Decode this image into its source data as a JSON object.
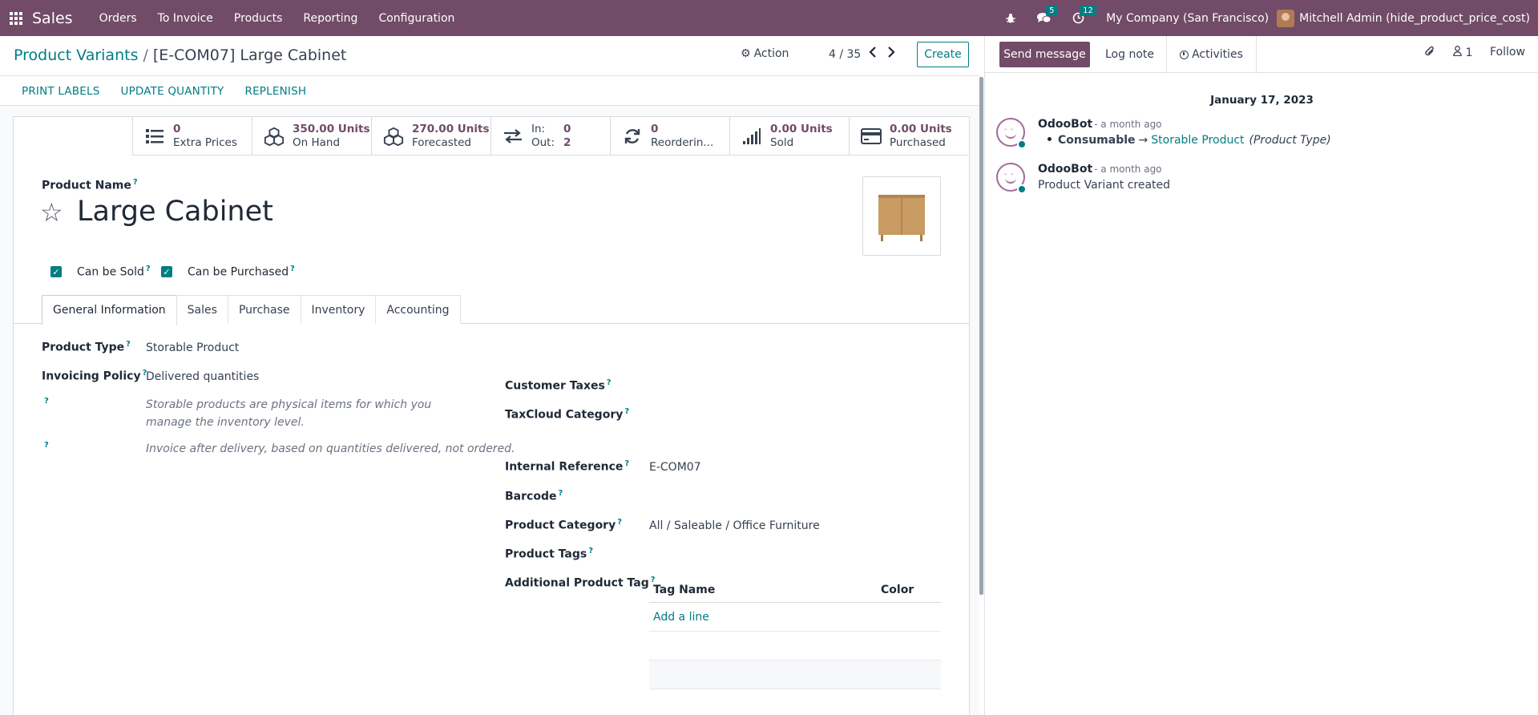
{
  "navbar": {
    "app_name": "Sales",
    "menu": [
      "Orders",
      "To Invoice",
      "Products",
      "Reporting",
      "Configuration"
    ],
    "messages_count": "5",
    "activities_count": "12",
    "company": "My Company (San Francisco)",
    "user": "Mitchell Admin (hide_product_price_cost)",
    "brand_color": "#714b67"
  },
  "control": {
    "breadcrumb_parent": "Product Variants",
    "breadcrumb_sep": "/",
    "breadcrumb_current": "[E-COM07] Large Cabinet",
    "action_label": "Action",
    "pager": "4 / 35",
    "create_label": "Create"
  },
  "status_buttons": [
    "PRINT LABELS",
    "UPDATE QUANTITY",
    "REPLENISH"
  ],
  "smart_buttons": {
    "extra_prices": {
      "value": "0",
      "label": "Extra Prices",
      "icon": "list-icon"
    },
    "on_hand": {
      "value": "350.00 Units",
      "label": "On Hand",
      "icon": "cubes-icon"
    },
    "forecasted": {
      "value": "270.00 Units",
      "label": "Forecasted",
      "icon": "cubes-icon"
    },
    "in_out": {
      "in_label": "In:",
      "in_value": "0",
      "out_label": "Out:",
      "out_value": "2",
      "icon": "exchange-icon"
    },
    "reordering": {
      "value": "0",
      "label": "Reorderin...",
      "icon": "refresh-icon"
    },
    "sold": {
      "value": "0.00 Units",
      "label": "Sold",
      "icon": "signal-icon"
    },
    "purchased": {
      "value": "0.00 Units",
      "label": "Purchased",
      "icon": "credit-card-icon"
    }
  },
  "form": {
    "product_name_label": "Product Name",
    "help_mark": "?",
    "product_name": "Large Cabinet",
    "can_be_sold_label": "Can be Sold",
    "can_be_purchased_label": "Can be Purchased",
    "tabs": [
      "General Information",
      "Sales",
      "Purchase",
      "Inventory",
      "Accounting"
    ],
    "product_type_label": "Product Type",
    "product_type": "Storable Product",
    "invoicing_policy_label": "Invoicing Policy",
    "invoicing_policy": "Delivered quantities",
    "help_storable": "Storable products are physical items for which you manage the inventory level.",
    "help_invoice": "Invoice after delivery, based on quantities delivered, not ordered.",
    "customer_taxes_label": "Customer Taxes",
    "taxcloud_label": "TaxCloud Category",
    "internal_ref_label": "Internal Reference",
    "internal_ref": "E-COM07",
    "barcode_label": "Barcode",
    "category_label": "Product Category",
    "category": "All / Saleable / Office Furniture",
    "tags_label": "Product Tags",
    "additional_tag_label": "Additional Product Tag",
    "tag_table": {
      "col_name": "Tag Name",
      "col_color": "Color",
      "add_line": "Add a line"
    }
  },
  "chatter": {
    "send_message": "Send message",
    "log_note": "Log note",
    "activities": "Activities",
    "followers_count": "1",
    "follow": "Follow",
    "date": "January 17, 2023",
    "messages": [
      {
        "author": "OdooBot",
        "time": "- a month ago",
        "old_value": "Consumable",
        "arrow": "→",
        "new_value": "Storable Product",
        "field": "(Product Type)"
      },
      {
        "author": "OdooBot",
        "time": "- a month ago",
        "body": "Product Variant created"
      }
    ]
  }
}
